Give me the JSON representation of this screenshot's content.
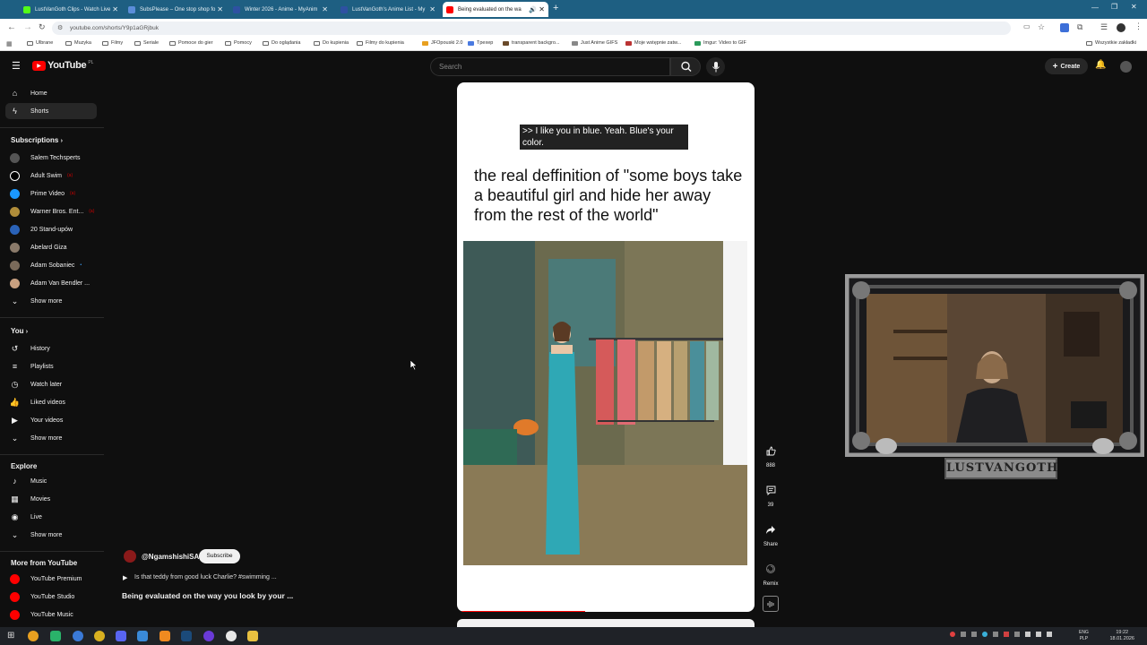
{
  "browser": {
    "tabs": [
      {
        "label": "LustVanGoth Clips - Watch Live",
        "favicon_color": "#53fc18"
      },
      {
        "label": "SubsPlease – One stop shop fo",
        "favicon_color": "#5b8dd9"
      },
      {
        "label": "Winter 2026 - Anime - MyAnim",
        "favicon_color": "#2e51a2"
      },
      {
        "label": "LustVanGoth's Anime List - My",
        "favicon_color": "#2e51a2"
      },
      {
        "label": "Being evaluated on the wa",
        "favicon_color": "#ff0000"
      }
    ],
    "url": "youtube.com/shorts/Y9p1aGRjbuk",
    "bookmarks": [
      "Ulbrane",
      "Muzyka",
      "Filmy",
      "Seriale",
      "Pomoce do gier",
      "Pomocy",
      "Do oglądania",
      "Do kupienia",
      "Filmy do kupienia",
      "JFOpouski 2.0",
      "Tpexep",
      "transparent backgro...",
      "Just Anime GIFS",
      "Moje wstępnie zatw...",
      "Imgur: Video to GIF"
    ],
    "all_bookmarks": "Wszystkie zakładki"
  },
  "youtube": {
    "logo": "YouTube",
    "logo_region": "PL",
    "search_placeholder": "Search",
    "create_label": "Create",
    "sidebar": {
      "main": [
        {
          "label": "Home",
          "icon": "home-icon"
        },
        {
          "label": "Shorts",
          "icon": "shorts-icon"
        }
      ],
      "subscriptions_label": "Subscriptions",
      "subscriptions": [
        {
          "label": "Salem Techsperts",
          "color": "#555555",
          "live": ""
        },
        {
          "label": "Adult Swim",
          "color": "#ffffff",
          "live": "(a)"
        },
        {
          "label": "Prime Video",
          "color": "#1a98ff",
          "live": "(a)"
        },
        {
          "label": "Warner Bros. Ent...",
          "color": "#b08d3a",
          "live": "(a)"
        },
        {
          "label": "20 Stand-upów",
          "color": "#2a62b8",
          "live": ""
        },
        {
          "label": "Abelard Giza",
          "color": "#8a7a6a",
          "live": ""
        },
        {
          "label": "Adam Sobaniec",
          "color": "#7a6a5a",
          "live": "•"
        },
        {
          "label": "Adam Van Bendler ...",
          "color": "#c8a080",
          "live": ""
        }
      ],
      "show_more": "Show more",
      "you_label": "You",
      "you": [
        {
          "label": "History",
          "icon": "history-icon"
        },
        {
          "label": "Playlists",
          "icon": "playlists-icon"
        },
        {
          "label": "Watch later",
          "icon": "watch-later-icon"
        },
        {
          "label": "Liked videos",
          "icon": "liked-videos-icon"
        },
        {
          "label": "Your videos",
          "icon": "your-videos-icon"
        }
      ],
      "explore_label": "Explore",
      "explore": [
        {
          "label": "Music",
          "icon": "music-icon"
        },
        {
          "label": "Movies",
          "icon": "movies-icon"
        },
        {
          "label": "Live",
          "icon": "live-icon"
        }
      ],
      "more_label": "More from YouTube",
      "more": [
        {
          "label": "YouTube Premium",
          "color": "#ff0000"
        },
        {
          "label": "YouTube Studio",
          "color": "#ff0000"
        },
        {
          "label": "YouTube Music",
          "color": "#ff0000"
        }
      ]
    },
    "short": {
      "caption": ">> I like you in blue. Yeah. Blue's your color.",
      "title": "the real deffinition of \"some boys take a beautiful girl and hide her away from the rest of the world\"",
      "progress": 0.43,
      "likes": "888",
      "comments": "39",
      "share_label": "Share",
      "remix_label": "Remix",
      "channel": "@NgamshishiSA",
      "subscribe_label": "Subscribe",
      "description": "Is that teddy from good luck Charlie?  #swimming ...",
      "video_title": "Being evaluated on the way you look by your ..."
    },
    "overlay_label": "LUSTVANGOTH"
  },
  "taskbar": {
    "lang_top": "ENG",
    "lang_bottom": "PLP",
    "time": "19:22",
    "date": "18.01.2026"
  }
}
